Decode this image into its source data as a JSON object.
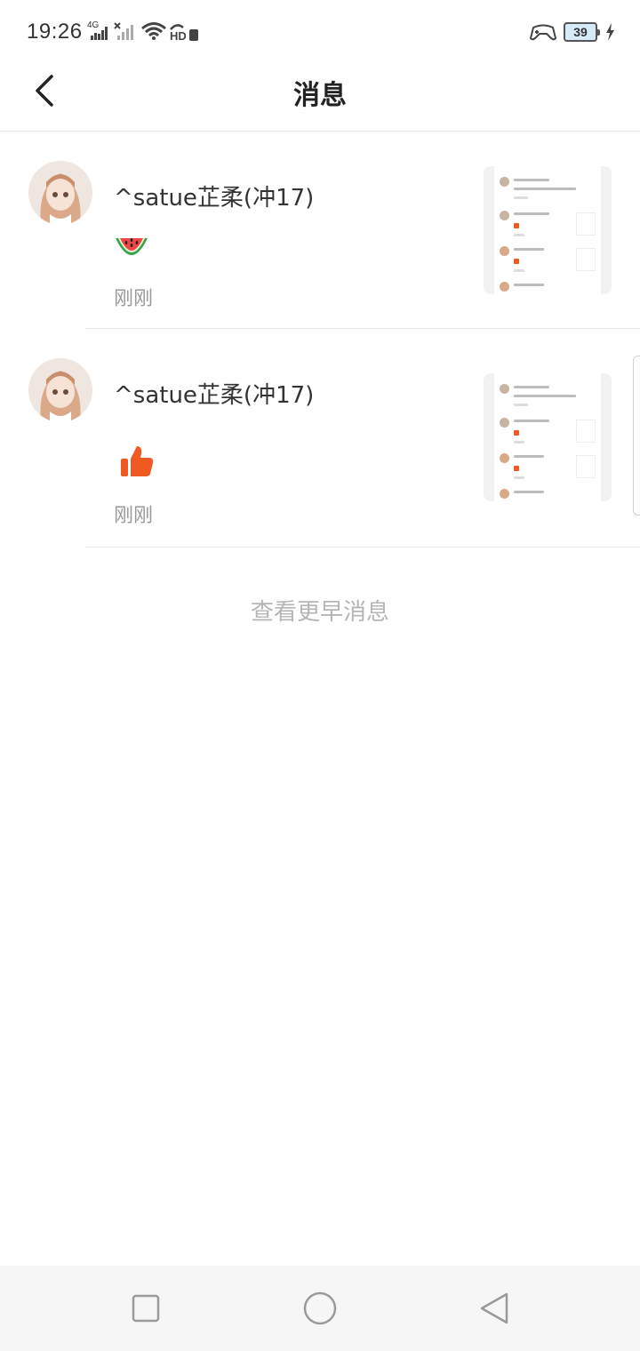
{
  "status_bar": {
    "time": "19:26",
    "network": "4G",
    "hd_label": "HD",
    "battery_level": "39",
    "icons": [
      "signal-icon",
      "signal-off-icon",
      "wifi-icon",
      "hd-icon",
      "game-controller-icon",
      "battery-icon",
      "charging-icon"
    ]
  },
  "header": {
    "title": "消息",
    "back_icon": "chevron-left-icon"
  },
  "messages": [
    {
      "username": "^satue芷柔(冲17)",
      "reaction": "watermelon-emoji",
      "time": "刚刚"
    },
    {
      "username": "^satue芷柔(冲17)",
      "reaction": "thumbs-up-icon",
      "time": "刚刚"
    }
  ],
  "load_earlier": "查看更早消息",
  "nav": {
    "recent": "square-icon",
    "home": "circle-icon",
    "back": "triangle-back-icon"
  },
  "colors": {
    "like": "#f05a22",
    "divider": "#e8e8e8",
    "muted_text": "#9a9a9a"
  }
}
